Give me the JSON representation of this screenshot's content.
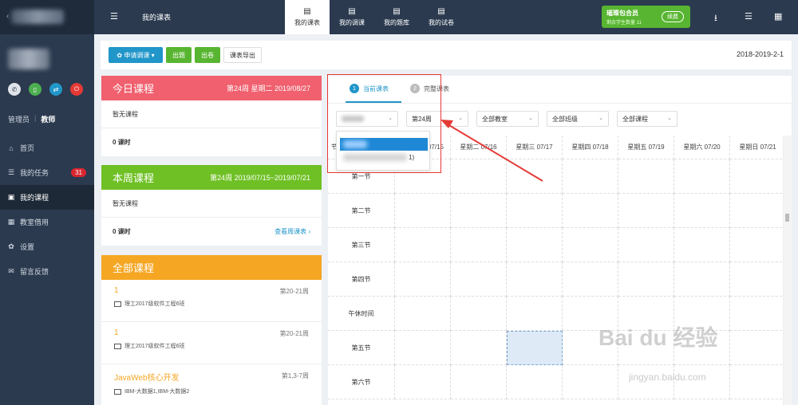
{
  "sidebar": {
    "roles": [
      "管理员",
      "教师"
    ],
    "nav": [
      {
        "label": "首页",
        "icon": "home-icon",
        "glyph": "⌂"
      },
      {
        "label": "我的任务",
        "icon": "list-icon",
        "glyph": "☰",
        "badge": "31"
      },
      {
        "label": "我的课程",
        "icon": "calendar-icon",
        "glyph": "▣"
      },
      {
        "label": "教室借用",
        "icon": "grid-icon",
        "glyph": "▦"
      },
      {
        "label": "设置",
        "icon": "gear-icon",
        "glyph": "✿"
      },
      {
        "label": "留言反馈",
        "icon": "chat-icon",
        "glyph": "✉"
      }
    ]
  },
  "topbar": {
    "title": "我的课表",
    "tabs": [
      {
        "label": "我的课表",
        "icon": "schedule-doc-icon"
      },
      {
        "label": "我的调课",
        "icon": "swap-doc-icon"
      },
      {
        "label": "我的题库",
        "icon": "bank-doc-icon"
      },
      {
        "label": "我的试卷",
        "icon": "paper-doc-icon"
      }
    ],
    "member": {
      "name": "璀璨包合员",
      "sub": "剩余学生数量 11",
      "renew": "续费"
    }
  },
  "toolbar": {
    "apply": "申请调课",
    "publish": "出题",
    "exam": "出卷",
    "export": "课表导出",
    "term": "2018-2019-2-1"
  },
  "today": {
    "title": "今日课程",
    "meta": "第24周 星期二 2019/08/27",
    "empty": "暂无课程",
    "hours": "0 课时"
  },
  "week": {
    "title": "本周课程",
    "meta": "第24周 2019/07/15~2019/07/21",
    "empty": "暂无课程",
    "hours": "0 课时",
    "link": "查看周课表 ›"
  },
  "all": {
    "title": "全部课程",
    "courses": [
      {
        "name": "1",
        "weeks": "第20-21周",
        "class": "理工2017级软件工程6班"
      },
      {
        "name": "1",
        "weeks": "第20-21周",
        "class": "理工2017级软件工程6班"
      },
      {
        "name": "JavaWeb核心开发",
        "weeks": "第1,3-7周",
        "class": "IBM-大数据1,IBM-大数据2"
      }
    ]
  },
  "schedule": {
    "tab_current": "当前课表",
    "tab_full": "完整课表",
    "filters": {
      "week": "第24周",
      "room": "全部教室",
      "class": "全部班级",
      "course": "全部课程"
    },
    "dropdown_partial": "1)",
    "days": [
      "星期一 07/15",
      "星期二 07/16",
      "星期三 07/17",
      "星期四 07/18",
      "星期五 07/19",
      "星期六 07/20",
      "星期日 07/21"
    ],
    "periods": [
      "第一节",
      "第二节",
      "第三节",
      "第四节",
      "午休时间",
      "第五节",
      "第六节"
    ],
    "header_partial": "节"
  },
  "colors": {
    "today": "#f0606e",
    "week": "#6fc024",
    "all": "#f5a623",
    "accent": "#2196c9"
  },
  "watermark": {
    "main": "Bai du 经验",
    "sub": "jingyan.baidu.com"
  }
}
